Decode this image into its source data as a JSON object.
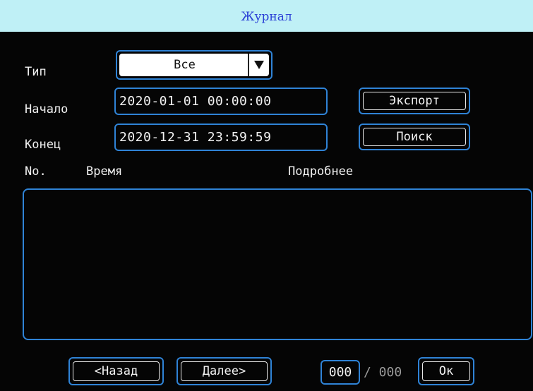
{
  "window": {
    "title": "Журнал"
  },
  "filters": {
    "type_label": "Тип",
    "type_value": "Все",
    "start_label": "Начало",
    "start_value": "2020-01-01 00:00:00",
    "end_label": "Конец",
    "end_value": "2020-12-31 23:59:59"
  },
  "actions": {
    "export_label": "Экспорт",
    "search_label": "Поиск"
  },
  "table": {
    "col_no": "No.",
    "col_time": "Время",
    "col_details": "Подробнее",
    "rows": []
  },
  "footer": {
    "prev_label": "<Назад",
    "next_label": "Далее>",
    "page_current": "000",
    "page_separator": "/ 000",
    "ok_label": "Ок"
  },
  "colors": {
    "accent": "#2f83d6",
    "title_bar": "#bff0f6",
    "background": "#050505"
  },
  "icons": {
    "dropdown": "triangle-down-icon"
  }
}
